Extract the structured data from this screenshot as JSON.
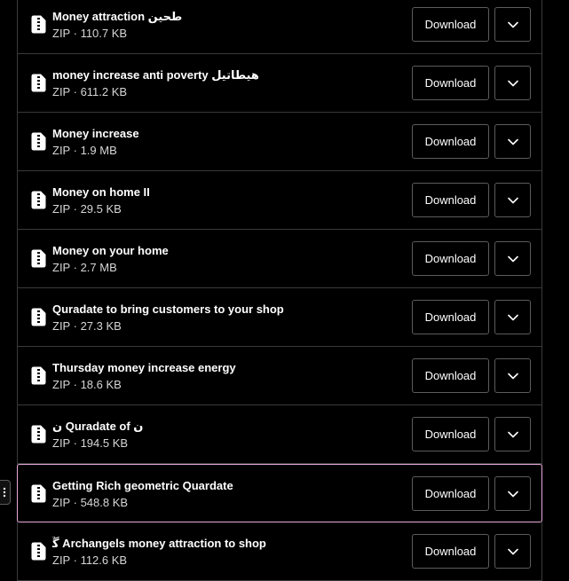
{
  "colors": {
    "background": "#000000",
    "divider": "#3a3a3a",
    "button_border": "#5c5c5c",
    "selected_border": "#e7a8dc"
  },
  "icons": {
    "file": "zip-file-icon",
    "menu": "chevron-down-icon",
    "drag": "drag-handle-icon"
  },
  "download_label": "Download",
  "files": [
    {
      "name": "Money attraction طحين",
      "type": "ZIP",
      "size": "110.7 KB",
      "selected": false
    },
    {
      "name": "money increase anti poverty هيطاتيل",
      "type": "ZIP",
      "size": "611.2 KB",
      "selected": false
    },
    {
      "name": "Money increase",
      "type": "ZIP",
      "size": "1.9 MB",
      "selected": false
    },
    {
      "name": "Money on home II",
      "type": "ZIP",
      "size": "29.5 KB",
      "selected": false
    },
    {
      "name": "Money on your home",
      "type": "ZIP",
      "size": "2.7 MB",
      "selected": false
    },
    {
      "name": "Quradate to bring customers to your shop",
      "type": "ZIP",
      "size": "27.3 KB",
      "selected": false
    },
    {
      "name": "Thursday money increase energy",
      "type": "ZIP",
      "size": "18.6 KB",
      "selected": false
    },
    {
      "name": "ن Quradate of ن",
      "type": "ZIP",
      "size": "194.5 KB",
      "selected": false
    },
    {
      "name": "Getting Rich geometric Quardate",
      "type": "ZIP",
      "size": "548.8 KB",
      "selected": true
    },
    {
      "name": "ﮜ Archangels money attraction to shop",
      "type": "ZIP",
      "size": "112.6 KB",
      "selected": false
    }
  ]
}
